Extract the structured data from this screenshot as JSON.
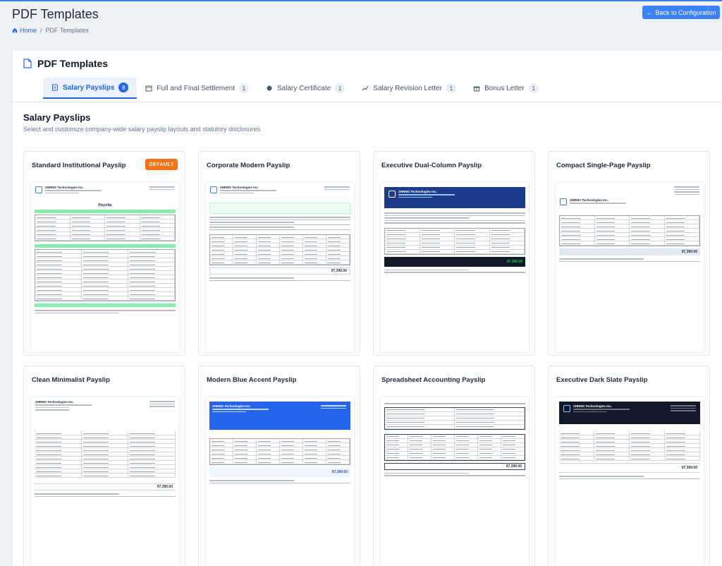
{
  "header": {
    "title": "PDF Templates",
    "breadcrumb_home": "Home",
    "breadcrumb_sep": "/",
    "breadcrumb_current": "PDF Templates",
    "back_button": "Back to Configuration"
  },
  "panel": {
    "title": "PDF Templates",
    "tabs": [
      {
        "label": "Salary Payslips",
        "count": "8",
        "icon": "document-icon"
      },
      {
        "label": "Full and Final Settlement",
        "count": "1",
        "icon": "calendar-icon"
      },
      {
        "label": "Salary Certificate",
        "count": "1",
        "icon": "badge-icon"
      },
      {
        "label": "Salary Revision Letter",
        "count": "1",
        "icon": "chart-line-icon"
      },
      {
        "label": "Bonus Letter",
        "count": "1",
        "icon": "gift-icon"
      }
    ]
  },
  "section": {
    "title": "Salary Payslips",
    "subtitle": "Select and customize company-wide salary payslip layouts and statutory disclosures."
  },
  "cards": [
    {
      "title": "Standard Institutional Payslip",
      "badge": "DEFAULT",
      "doc_title": "Payslip",
      "company": "ZHRMS Technologies Inc."
    },
    {
      "title": "Corporate Modern Payslip",
      "company": "ZHRMS Technologies Inc.",
      "total": "97,390.00"
    },
    {
      "title": "Executive Dual-Column Payslip",
      "company": "ZHRMS Technologies Inc.",
      "total": "97,390.00"
    },
    {
      "title": "Compact Single-Page Payslip",
      "company": "ZHRMS Technologies Inc.",
      "total": "97,390.00"
    },
    {
      "title": "Clean Minimalist Payslip",
      "company": "ZHRMS Technologies Inc.",
      "total": "97,390.00"
    },
    {
      "title": "Modern Blue Accent Payslip",
      "company": "ZHRMS Technologies Inc.",
      "total": "97,390.00"
    },
    {
      "title": "Spreadsheet Accounting Payslip",
      "company": "ZHRMS Technologies Inc.",
      "total": "97,390.00"
    },
    {
      "title": "Executive Dark Slate Payslip",
      "company": "ZHRMS Technologies Inc.",
      "total": "97,390.00"
    }
  ],
  "colors": {
    "accent": "#2563eb",
    "badge": "#f97316"
  }
}
